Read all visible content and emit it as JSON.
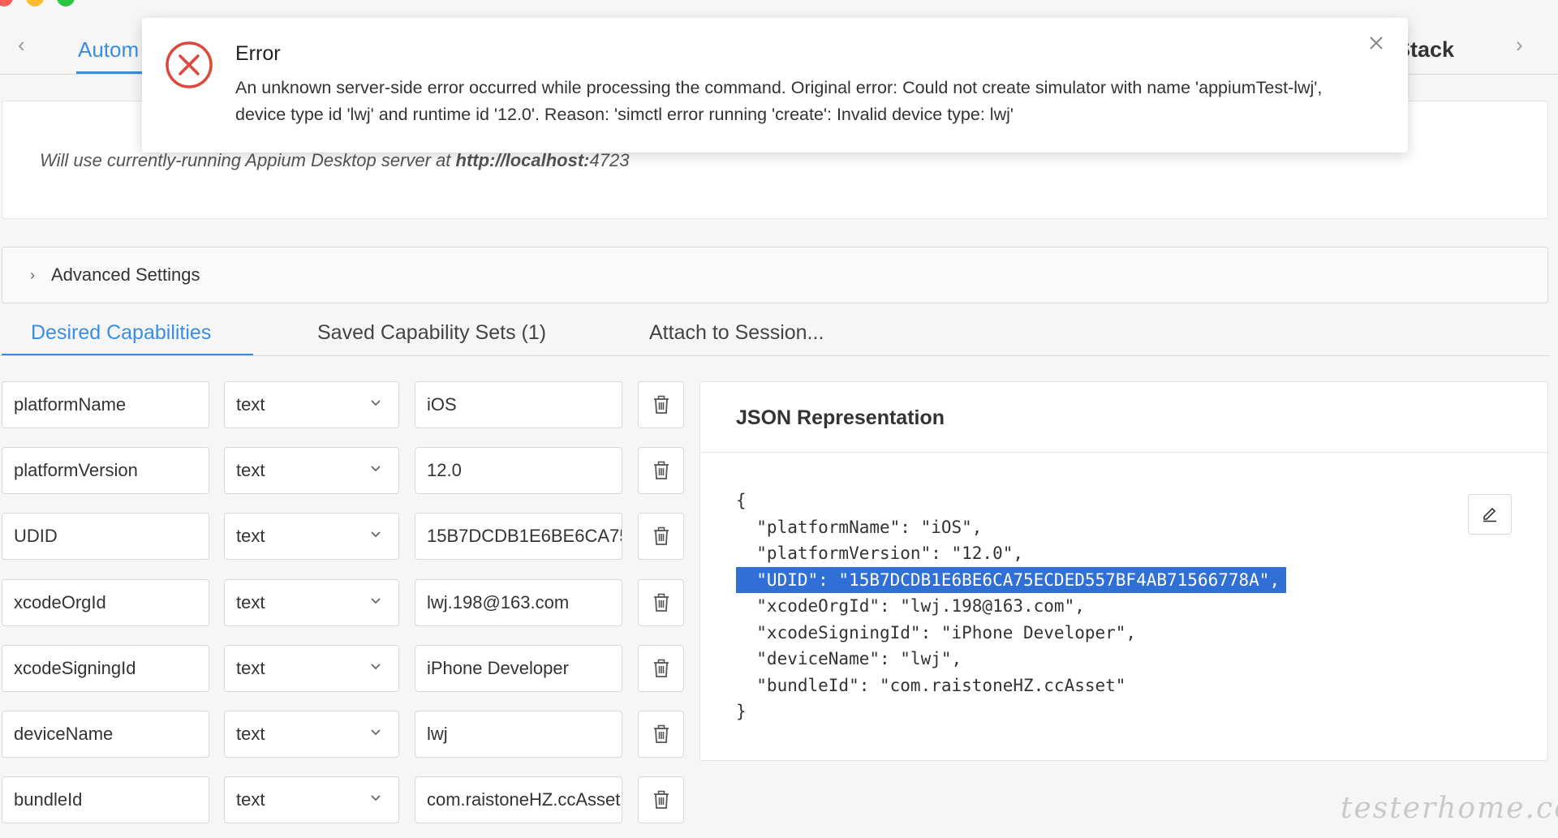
{
  "top_tabs": {
    "active_label": "Autom",
    "right_label": "Stack"
  },
  "server": {
    "prefix": "Will use currently-running Appium Desktop server at ",
    "url_bold": "http://localhost:",
    "port": "4723"
  },
  "advanced": {
    "label": "Advanced Settings"
  },
  "cap_tabs": [
    {
      "label": "Desired Capabilities"
    },
    {
      "label": "Saved Capability Sets (1)"
    },
    {
      "label": "Attach to Session..."
    }
  ],
  "capabilities": [
    {
      "name": "platformName",
      "type": "text",
      "value": "iOS"
    },
    {
      "name": "platformVersion",
      "type": "text",
      "value": "12.0"
    },
    {
      "name": "UDID",
      "type": "text",
      "value": "15B7DCDB1E6BE6CA75ECDED557BF4AB71566778A"
    },
    {
      "name": "xcodeOrgId",
      "type": "text",
      "value": "lwj.198@163.com"
    },
    {
      "name": "xcodeSigningId",
      "type": "text",
      "value": "iPhone Developer"
    },
    {
      "name": "deviceName",
      "type": "text",
      "value": "lwj"
    },
    {
      "name": "bundleId",
      "type": "text",
      "value": "com.raistoneHZ.ccAsset"
    }
  ],
  "json_panel": {
    "title": "JSON Representation",
    "lines": [
      "{",
      "  \"platformName\": \"iOS\",",
      "  \"platformVersion\": \"12.0\",",
      "  \"UDID\": \"15B7DCDB1E6BE6CA75ECDED557BF4AB71566778A\",",
      "  \"xcodeOrgId\": \"lwj.198@163.com\",",
      "  \"xcodeSigningId\": \"iPhone Developer\",",
      "  \"deviceName\": \"lwj\",",
      "  \"bundleId\": \"com.raistoneHZ.ccAsset\"",
      "}"
    ],
    "selected_line_index": 3
  },
  "error": {
    "title": "Error",
    "message": "An unknown server-side error occurred while processing the command. Original error: Could not create simulator with name 'appiumTest-lwj', device type id 'lwj' and runtime id '12.0'. Reason: 'simctl error running 'create': Invalid device type: lwj'"
  },
  "watermark": "testerhome.com",
  "colors": {
    "accent": "#3b8de0",
    "error": "#e0463c",
    "selection": "#2f6fd6"
  }
}
